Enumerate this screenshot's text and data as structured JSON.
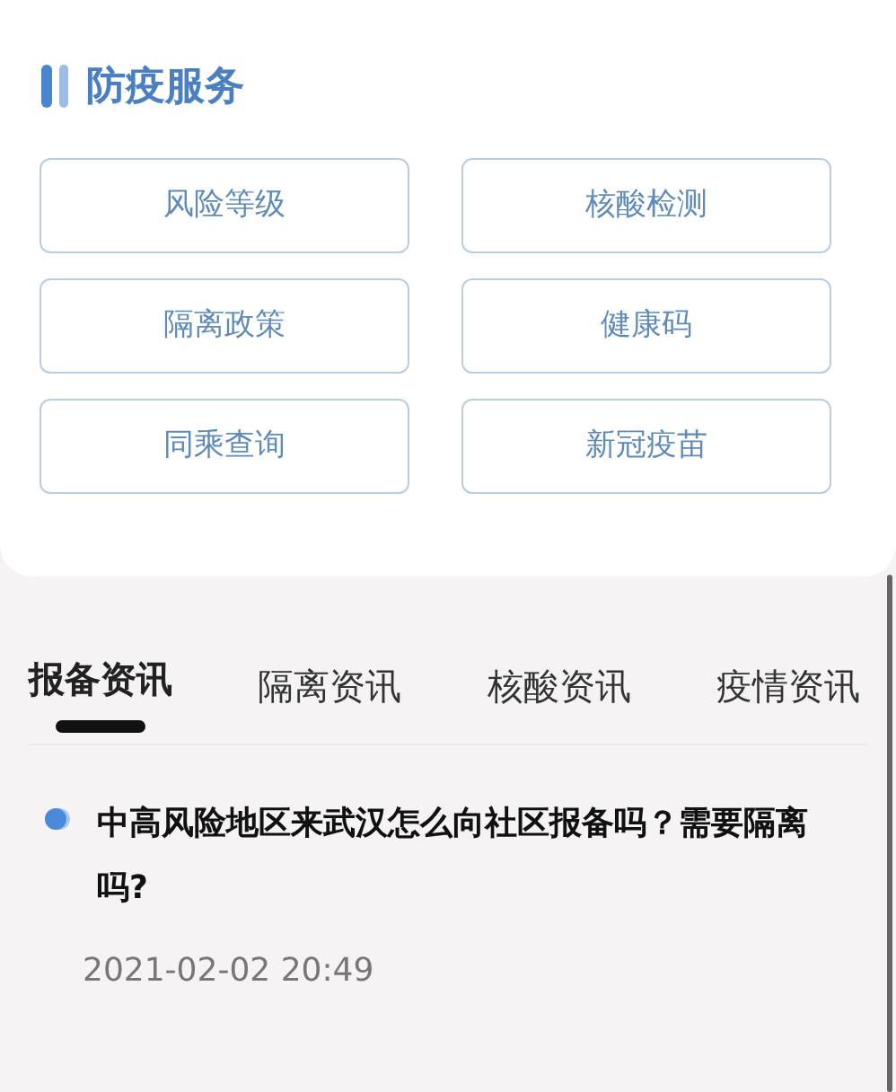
{
  "section": {
    "title": "防疫服务"
  },
  "services": [
    {
      "label": "风险等级"
    },
    {
      "label": "核酸检测"
    },
    {
      "label": "隔离政策"
    },
    {
      "label": "健康码"
    },
    {
      "label": "同乘查询"
    },
    {
      "label": "新冠疫苗"
    }
  ],
  "tabs": [
    {
      "label": "报备资讯",
      "selected": true
    },
    {
      "label": "隔离资讯",
      "selected": false
    },
    {
      "label": "核酸资讯",
      "selected": false
    },
    {
      "label": "疫情资讯",
      "selected": false
    }
  ],
  "articles": [
    {
      "title": "中高风险地区来武汉怎么向社区报备吗？需要隔离吗?",
      "time": "2021-02-02 20:49"
    }
  ]
}
